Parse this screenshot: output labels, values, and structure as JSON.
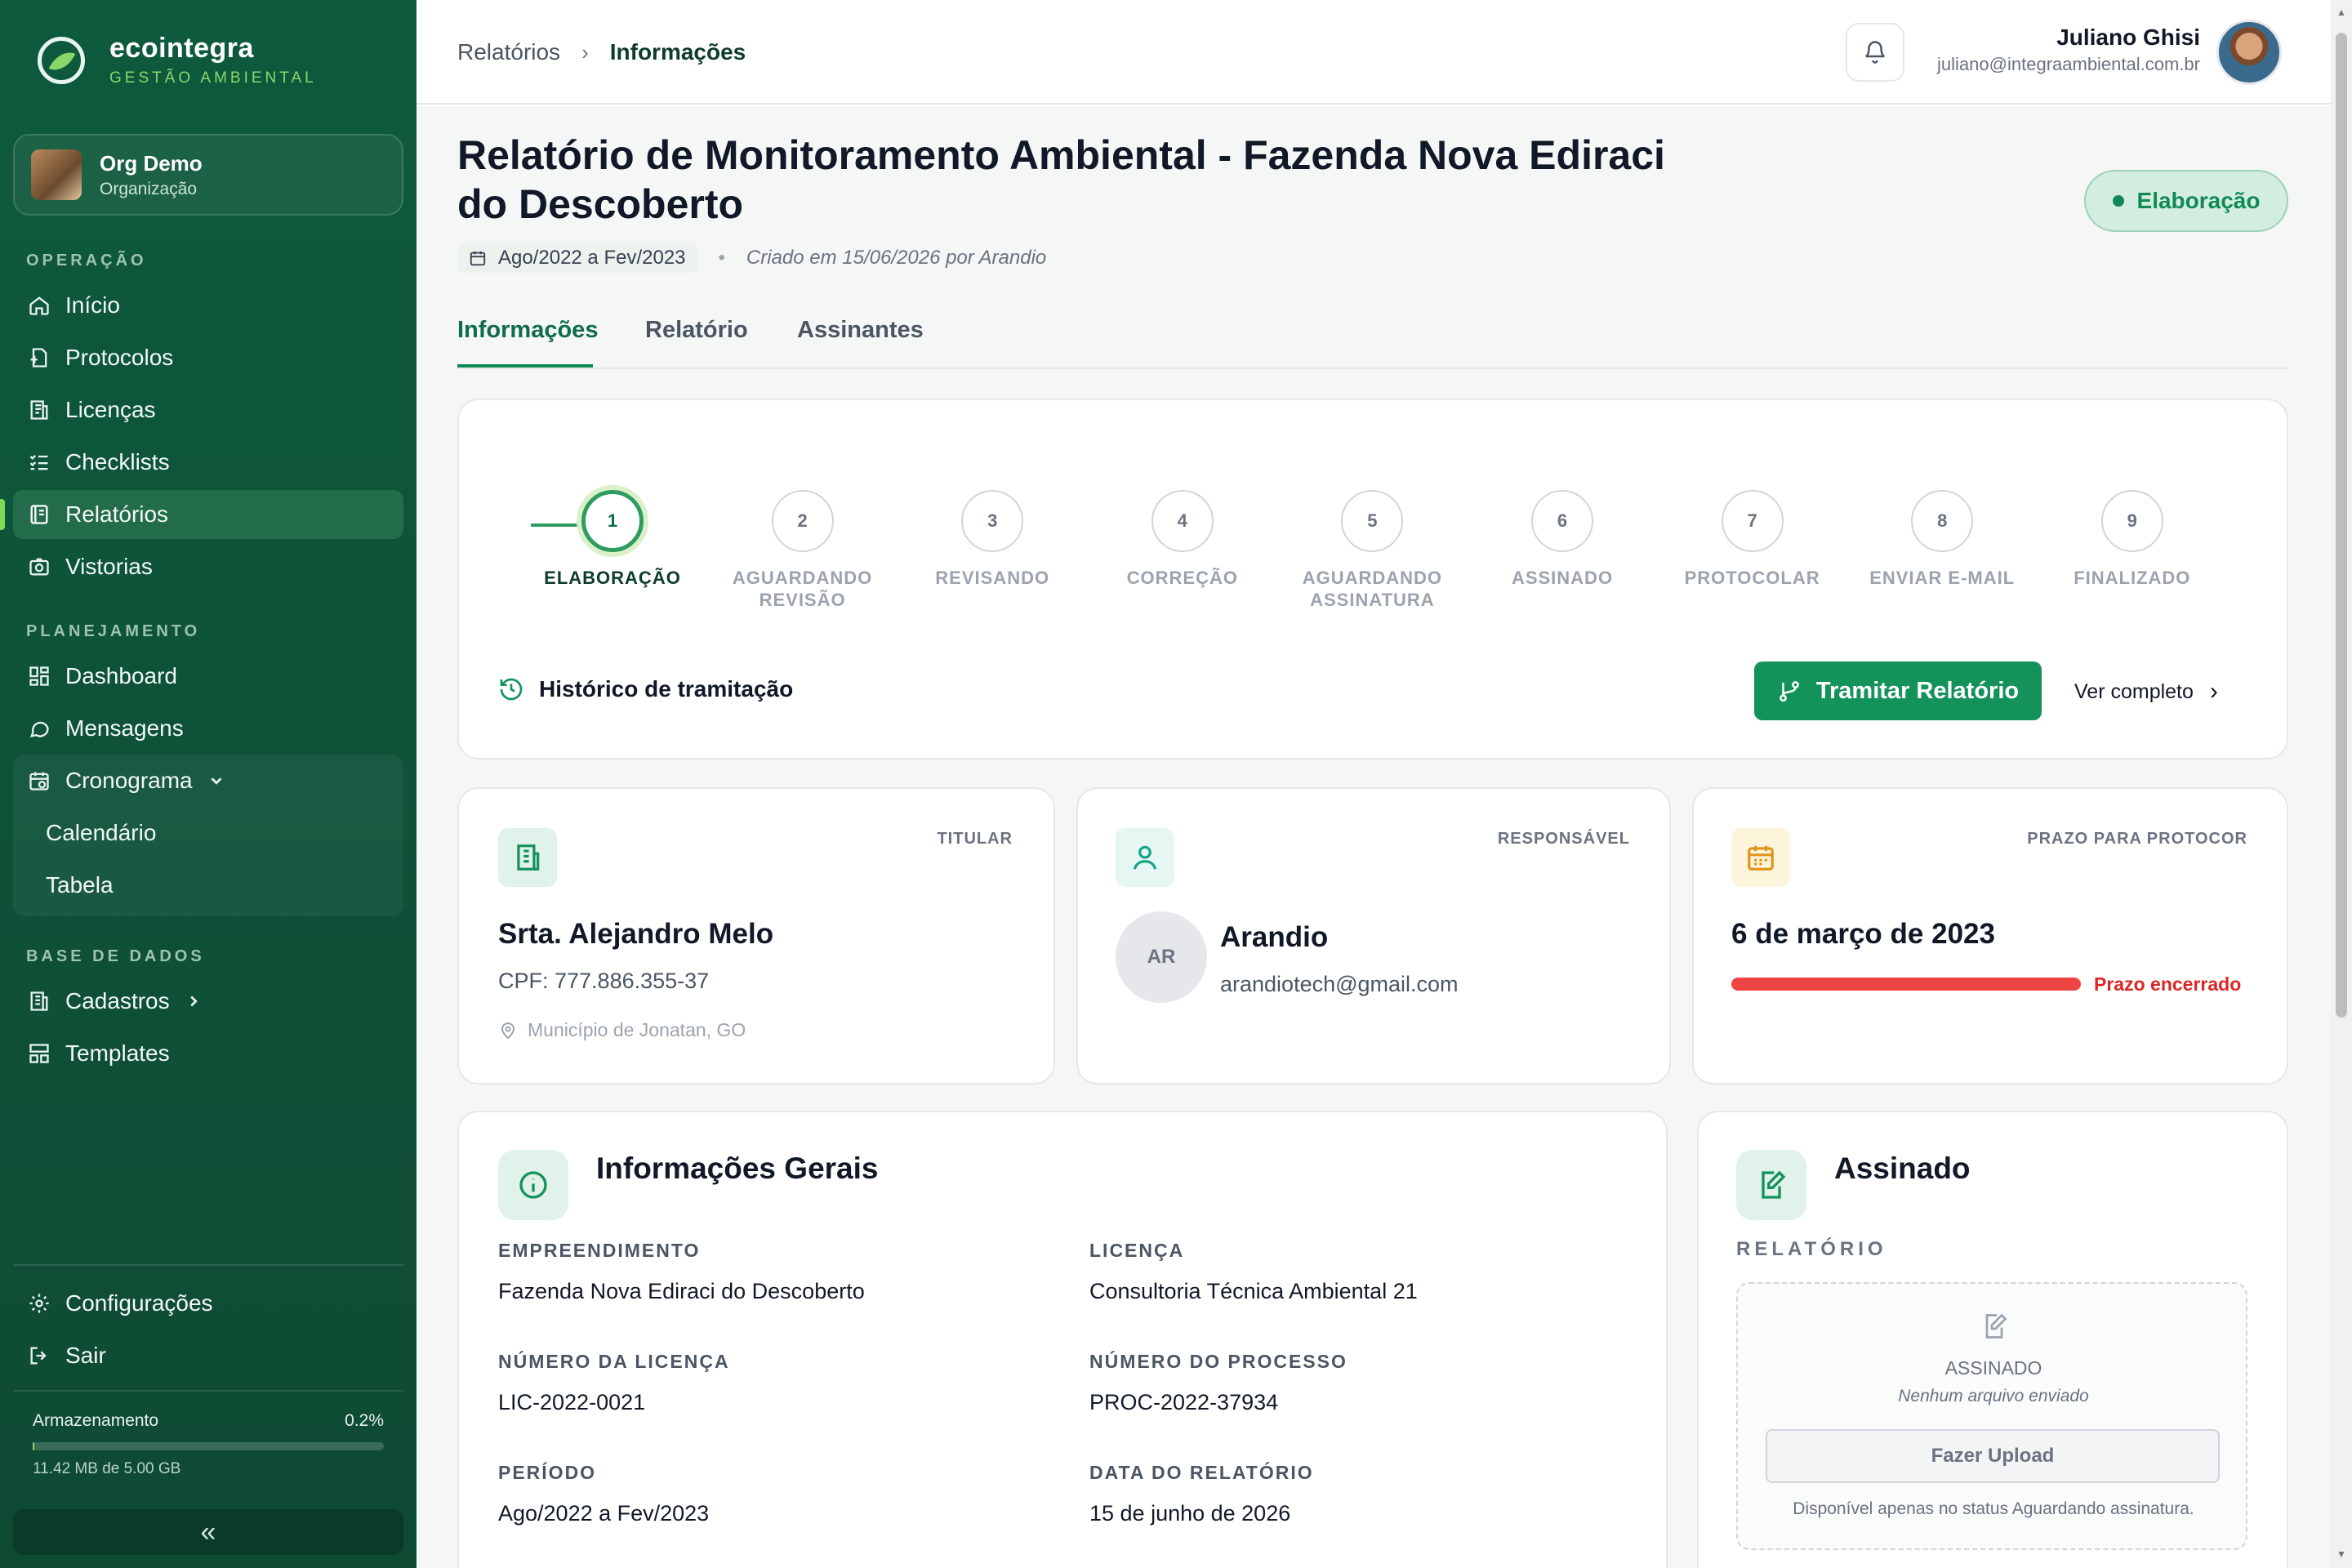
{
  "brand": {
    "name": "ecointegra",
    "subtitle": "GESTÃO AMBIENTAL"
  },
  "org": {
    "name": "Org Demo",
    "role": "Organização"
  },
  "sidebar": {
    "sections": {
      "operacao": "OPERAÇÃO",
      "planejamento": "PLANEJAMENTO",
      "base": "BASE DE DADOS"
    },
    "items": {
      "inicio": "Início",
      "protocolos": "Protocolos",
      "licencas": "Licenças",
      "checklists": "Checklists",
      "relatorios": "Relatórios",
      "vistorias": "Vistorias",
      "dashboard": "Dashboard",
      "mensagens": "Mensagens",
      "cronograma": "Cronograma",
      "calendario": "Calendário",
      "tabela": "Tabela",
      "cadastros": "Cadastros",
      "templates": "Templates",
      "configuracoes": "Configurações",
      "sair": "Sair"
    },
    "active": "relatorios",
    "storage": {
      "label": "Armazenamento",
      "percent": "0.2%",
      "fraction": 0.002,
      "detail": "11.42 MB de 5.00 GB"
    },
    "collapse_glyph": "«"
  },
  "breadcrumb": {
    "parent": "Relatórios",
    "current": "Informações"
  },
  "user": {
    "name": "Juliano Ghisi",
    "email": "juliano@integraambiental.com.br"
  },
  "header": {
    "title": "Relatório de Monitoramento Ambiental - Fazenda Nova Ediraci do Descoberto",
    "status": "Elaboração",
    "period": "Ago/2022 a Fev/2023",
    "created": "Criado em 15/06/2026 por Arandio"
  },
  "tabs": {
    "info": "Informações",
    "relatorio": "Relatório",
    "assinantes": "Assinantes"
  },
  "stepper": {
    "steps": [
      {
        "num": "1",
        "label": "ELABORAÇÃO",
        "label2": ""
      },
      {
        "num": "2",
        "label": "AGUARDANDO",
        "label2": "REVISÃO"
      },
      {
        "num": "3",
        "label": "REVISANDO",
        "label2": ""
      },
      {
        "num": "4",
        "label": "CORREÇÃO",
        "label2": ""
      },
      {
        "num": "5",
        "label": "AGUARDANDO",
        "label2": "ASSINATURA"
      },
      {
        "num": "6",
        "label": "ASSINADO",
        "label2": ""
      },
      {
        "num": "7",
        "label": "PROTOCOLAR",
        "label2": ""
      },
      {
        "num": "8",
        "label": "ENVIAR E-MAIL",
        "label2": ""
      },
      {
        "num": "9",
        "label": "FINALIZADO",
        "label2": ""
      }
    ],
    "current_step": 1,
    "history_label": "Histórico de tramitação",
    "tramitar_label": "Tramitar Relatório",
    "ver_completo": "Ver completo"
  },
  "titular": {
    "label": "TITULAR",
    "name": "Srta. Alejandro Melo",
    "cpf": "CPF: 777.886.355-37",
    "location": "Município de Jonatan, GO"
  },
  "responsavel": {
    "label": "RESPONSÁVEL",
    "initials": "AR",
    "name": "Arandio",
    "email": "arandiotech@gmail.com"
  },
  "prazo": {
    "label": "PRAZO PARA PROTOCOR",
    "date": "6 de março de 2023",
    "status": "Prazo encerrado"
  },
  "info_gerais": {
    "title": "Informações Gerais",
    "fields": {
      "empreendimento_label": "EMPREENDIMENTO",
      "empreendimento": "Fazenda Nova Ediraci do Descoberto",
      "licenca_label": "LICENÇA",
      "licenca": "Consultoria Técnica Ambiental 21",
      "num_licenca_label": "NÚMERO DA LICENÇA",
      "num_licenca": "LIC-2022-0021",
      "num_processo_label": "NÚMERO DO PROCESSO",
      "num_processo": "PROC-2022-37934",
      "periodo_label": "PERÍODO",
      "periodo": "Ago/2022 a Fev/2023",
      "data_label": "DATA DO RELATÓRIO",
      "data": "15 de junho de 2026"
    }
  },
  "assinado": {
    "title": "Assinado",
    "section": "RELATÓRIO",
    "status": "ASSINADO",
    "note": "Nenhum arquivo enviado",
    "upload_label": "Fazer Upload",
    "help": "Disponível apenas no status Aguardando assinatura."
  },
  "colors": {
    "primary": "#13935a",
    "sidebar": "#0e5a3c",
    "accent": "#8bd66b",
    "danger": "#ef4444"
  }
}
